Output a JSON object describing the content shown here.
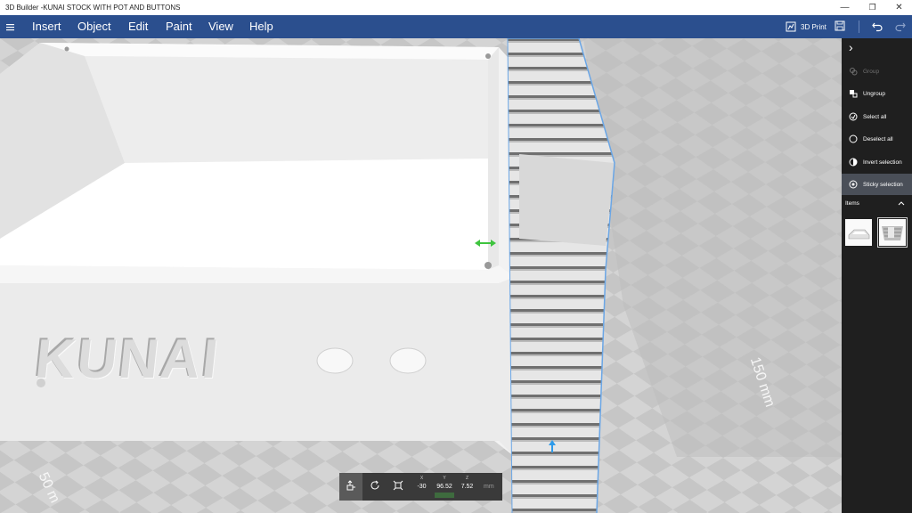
{
  "window": {
    "title": "3D Builder -KUNAI STOCK WITH POT AND BUTTONS",
    "minimize_glyph": "—",
    "maximize_glyph": "❐",
    "close_glyph": "✕"
  },
  "menu": {
    "items": [
      "Insert",
      "Object",
      "Edit",
      "Paint",
      "View",
      "Help"
    ]
  },
  "toolbar": {
    "print_label": "3D Print",
    "icons": [
      "print-3d-icon",
      "save-icon",
      "undo-icon",
      "redo-icon"
    ]
  },
  "sidepanel": {
    "collapse_glyph": "›",
    "actions": [
      {
        "label": "Group",
        "icon": "group-icon",
        "enabled": false
      },
      {
        "label": "Ungroup",
        "icon": "ungroup-icon",
        "enabled": true
      },
      {
        "label": "Select all",
        "icon": "select-all-icon",
        "enabled": true
      },
      {
        "label": "Deselect all",
        "icon": "deselect-all-icon",
        "enabled": true
      },
      {
        "label": "Invert selection",
        "icon": "invert-selection-icon",
        "enabled": true
      },
      {
        "label": "Sticky selection",
        "icon": "sticky-selection-icon",
        "enabled": true,
        "active": true
      }
    ],
    "items_label": "Items"
  },
  "viewport": {
    "engraved_text": "KUNAI",
    "scale_right": "150 mm",
    "scale_left": "50 m"
  },
  "transform_bar": {
    "tools": [
      "move-icon",
      "rotate-icon",
      "scale-icon"
    ],
    "x_label": "X",
    "x_value": "-30",
    "y_label": "Y",
    "y_value": "96.52",
    "z_label": "Z",
    "z_value": "7.52",
    "unit": "mm"
  },
  "colors": {
    "menubar": "#2b4f8e",
    "panel": "#1f1f1f",
    "active_item": "#4a4f58",
    "selection_outline": "#6aa6e6",
    "move_handle_green": "#3ec43e",
    "move_handle_blue": "#2e9bea"
  }
}
